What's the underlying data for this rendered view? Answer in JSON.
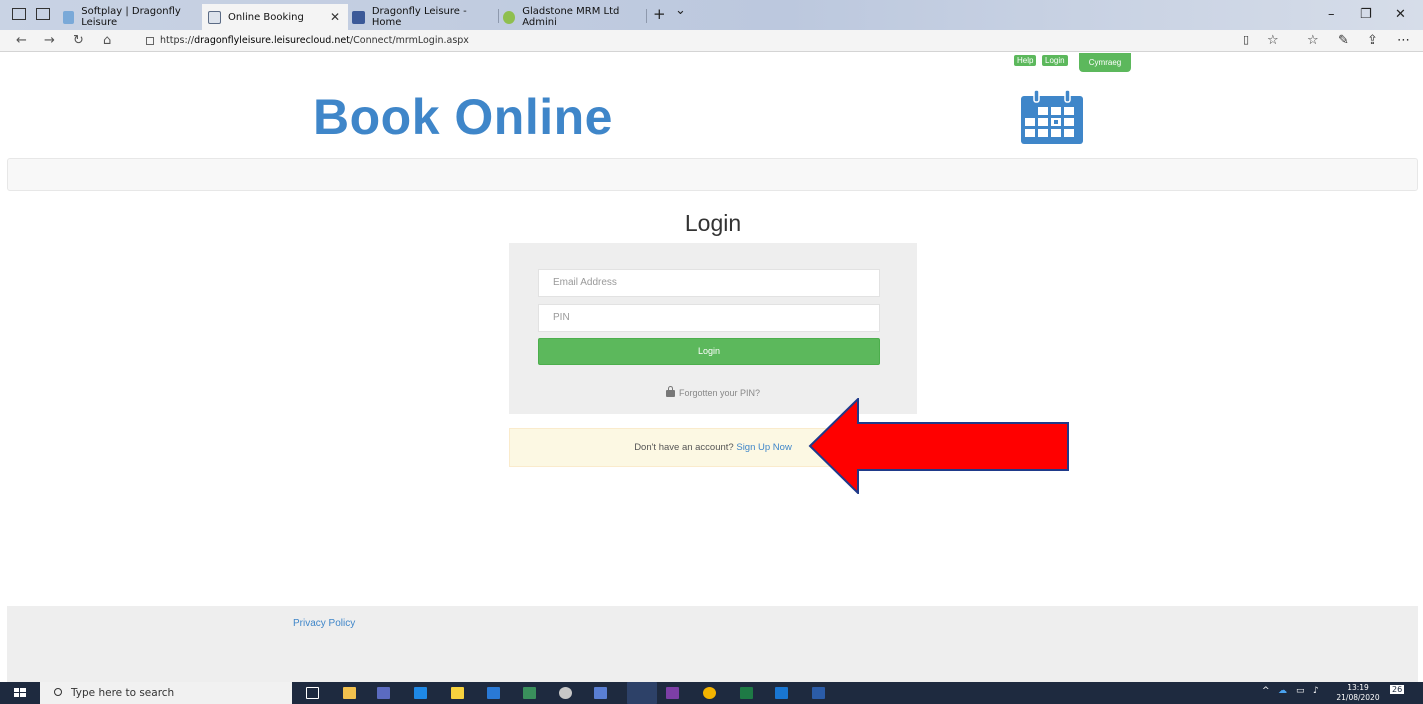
{
  "browser": {
    "tabs": [
      {
        "label": "Softplay | Dragonfly Leisure",
        "active": false
      },
      {
        "label": "Online Booking",
        "active": true
      },
      {
        "label": "Dragonfly Leisure - Home",
        "active": false
      },
      {
        "label": "Gladstone MRM Ltd Admini",
        "active": false
      }
    ],
    "new_tab_icon": "+",
    "tab_menu_icon": "⌄",
    "url_prefix": "https://",
    "url_host": "dragonflyleisure.leisurecloud.net",
    "url_path": "/Connect/mrmLogin.aspx"
  },
  "header": {
    "help_label": "Help",
    "login_label": "Login",
    "language_label": "Cymraeg",
    "title": "Book Online",
    "calendar_icon": "calendar-icon"
  },
  "login": {
    "heading": "Login",
    "email_placeholder": "Email Address",
    "pin_placeholder": "PIN",
    "button_label": "Login",
    "forgot_label": "Forgotten your PIN?",
    "signup_prompt": "Don't have an account?",
    "signup_link": "Sign Up Now"
  },
  "annotation": {
    "arrow_color": "#ff0000",
    "arrow_outline": "#1f3a8a"
  },
  "footer": {
    "privacy_link": "Privacy Policy"
  },
  "taskbar": {
    "search_placeholder": "Type here to search",
    "time": "13:19",
    "date": "21/08/2020",
    "notification_count": "26"
  },
  "colors": {
    "brand_blue": "#3f86c9",
    "success_green": "#5cb85c",
    "signup_bg": "#fcf8e3"
  }
}
